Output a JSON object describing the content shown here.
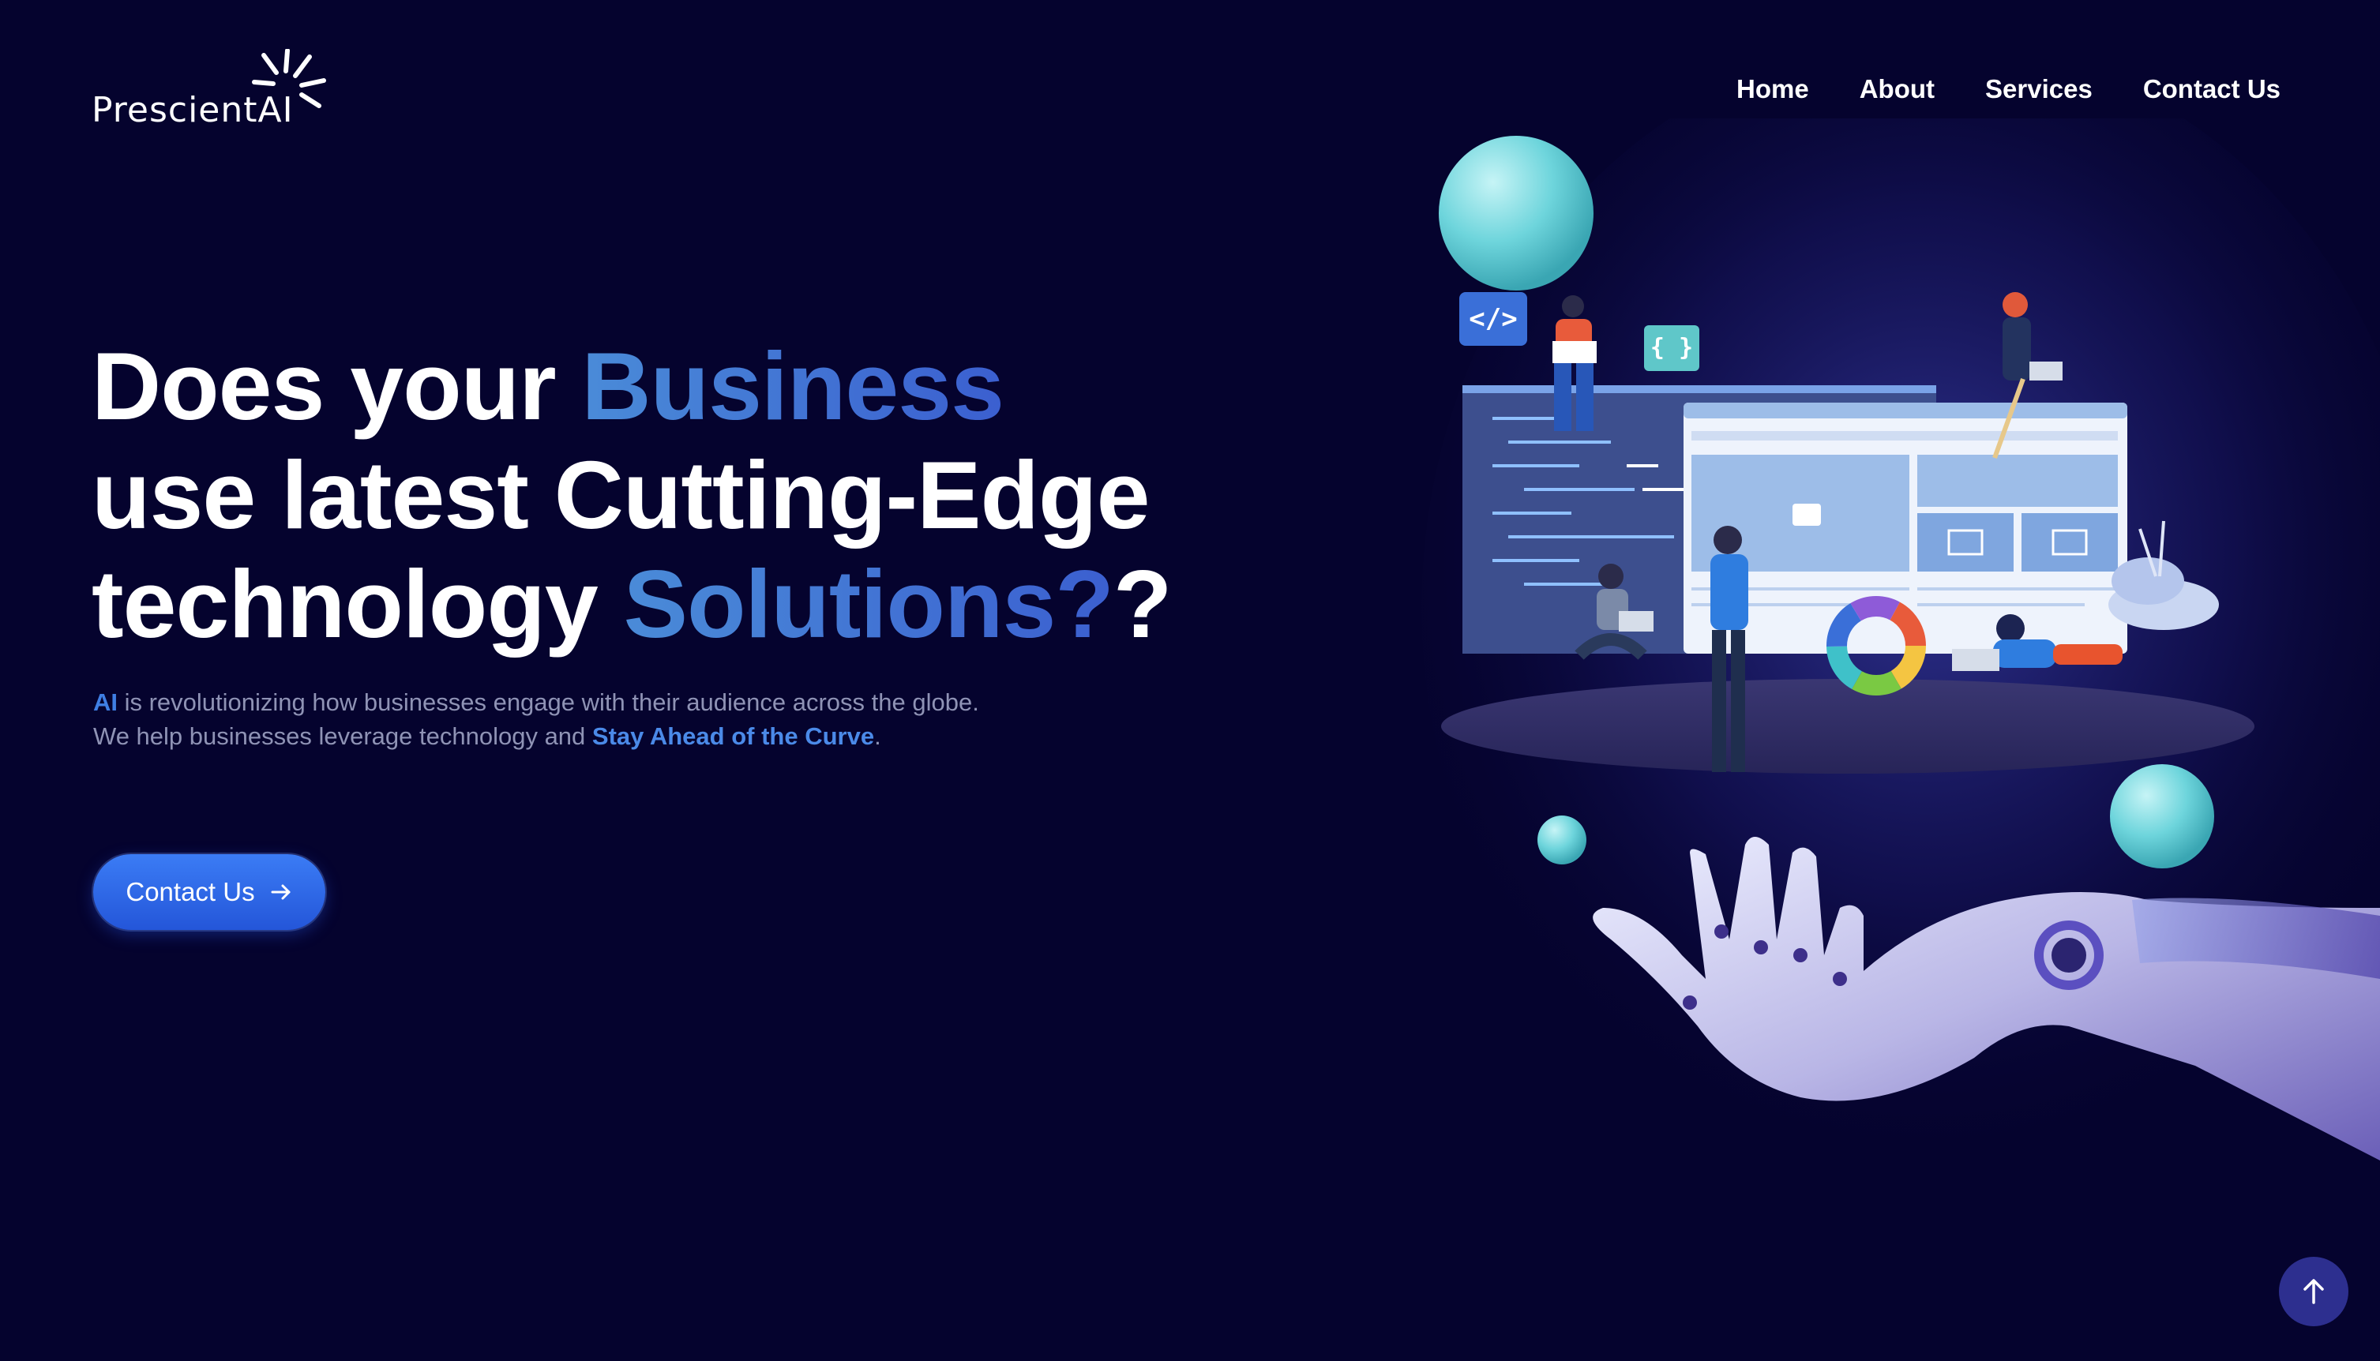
{
  "brand": {
    "name": "PrescientAI"
  },
  "nav": {
    "items": [
      "Home",
      "About",
      "Services",
      "Contact Us"
    ]
  },
  "hero": {
    "line1_plain": "Does your ",
    "line1_accent": "Business",
    "line2_plain": "use latest Cutting-Edge",
    "line3_plain": "technology ",
    "line3_accent": "Solutions?",
    "line3_tail": "?",
    "sub_ai": "AI",
    "sub_line1_rest": " is revolutionizing how businesses engage with their audience across the globe.",
    "sub_line2_start": "We help businesses leverage technology and ",
    "sub_line2_accent": "Stay Ahead of the Curve",
    "sub_line2_end": ".",
    "cta_label": "Contact Us"
  },
  "illustration": {
    "code_tag": "</>",
    "brace_tag": "{ }"
  },
  "icons": {
    "cta": "arrow-right-icon",
    "scroll_top": "arrow-up-icon",
    "logo": "sunburst-icon"
  },
  "colors": {
    "background": "#05032e",
    "accent": "#3f7fe4",
    "cta": "#2f6cf0",
    "sphere": "#6fd7dc"
  }
}
